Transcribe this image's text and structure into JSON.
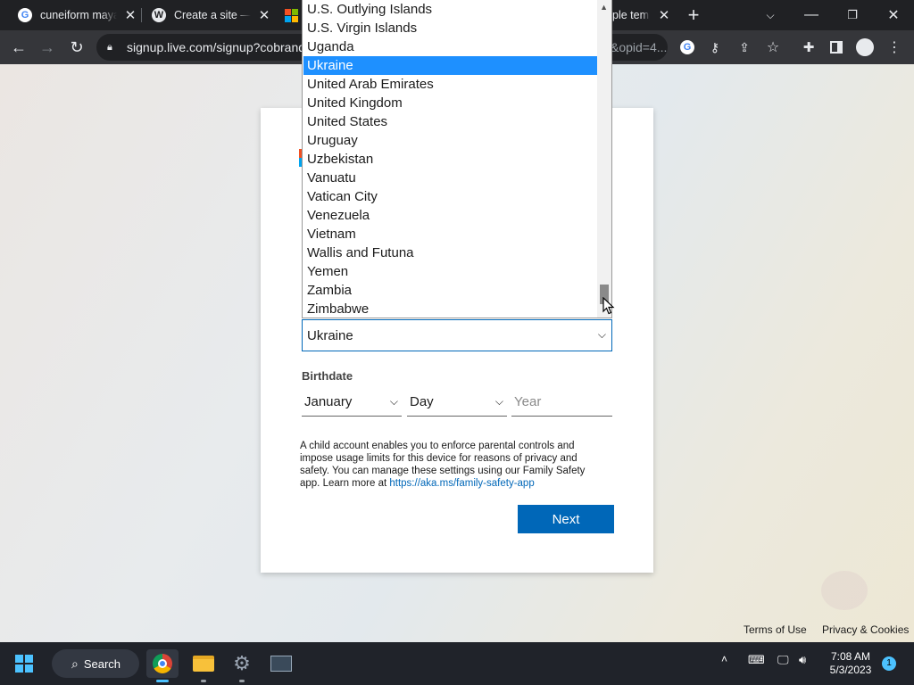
{
  "browser": {
    "tabs": [
      {
        "title": "cuneiform maya",
        "icon": "google-icon"
      },
      {
        "title": "Create a site —",
        "icon": "wordpress-icon"
      },
      {
        "title": "ple temp",
        "icon": "microsoft-icon"
      }
    ],
    "url": "signup.live.com/signup?cobrand",
    "url_tail": "&opid=4..."
  },
  "dropdown": {
    "options": [
      "U.S. Outlying Islands",
      "U.S. Virgin Islands",
      "Uganda",
      "Ukraine",
      "United Arab Emirates",
      "United Kingdom",
      "United States",
      "Uruguay",
      "Uzbekistan",
      "Vanuatu",
      "Vatican City",
      "Venezuela",
      "Vietnam",
      "Wallis and Futuna",
      "Yemen",
      "Zambia",
      "Zimbabwe"
    ],
    "selected": "Ukraine"
  },
  "form": {
    "country_value": "Ukraine",
    "birthdate_label": "Birthdate",
    "month_value": "January",
    "day_placeholder": "Day",
    "year_placeholder": "Year",
    "info_text": "A child account enables you to enforce parental controls and impose usage limits for this device for reasons of privacy and safety. You can manage these settings using our Family Safety app. Learn more at ",
    "info_link": "https://aka.ms/family-safety-app",
    "next_label": "Next"
  },
  "footer": {
    "terms": "Terms of Use",
    "privacy": "Privacy & Cookies"
  },
  "taskbar": {
    "search_label": "Search",
    "time": "7:08 AM",
    "date": "5/3/2023",
    "notification_count": "1"
  },
  "colors": {
    "accent": "#0067b8",
    "selection": "#1e90ff",
    "chrome_dark": "#202124"
  }
}
